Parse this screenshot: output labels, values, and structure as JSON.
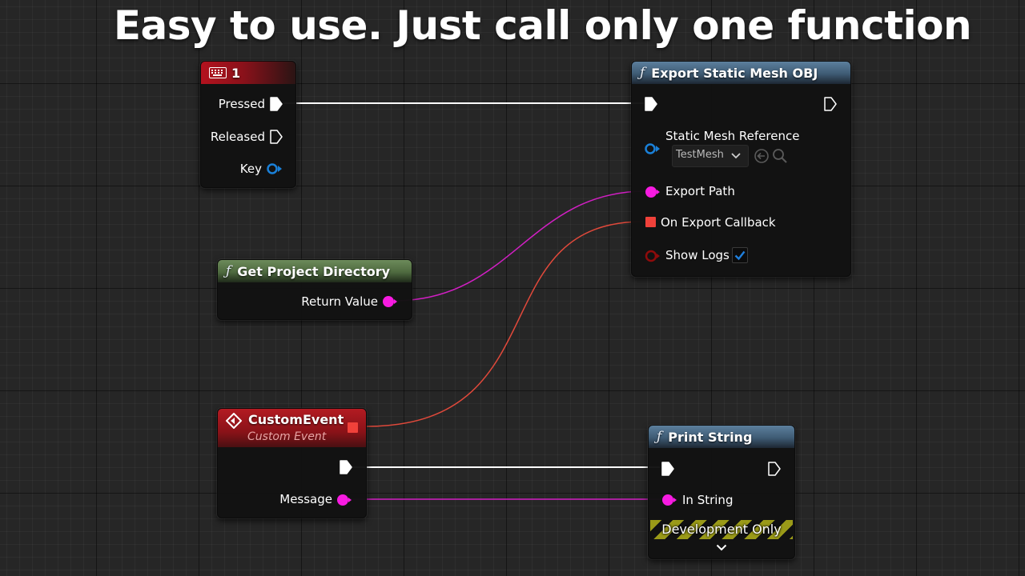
{
  "headline": "Easy to use. Just call only one function",
  "colors": {
    "exec_wire": "#ffffff",
    "string_pin": "#f71be1",
    "delegate_pin": "#f0413a",
    "struct_pin": "#1a80d8",
    "bool_pin": "#8f0b0b"
  },
  "nodes": {
    "key_event": {
      "icon": "keyboard-icon",
      "title": "1",
      "pins": {
        "pressed": "Pressed",
        "released": "Released",
        "key": "Key"
      }
    },
    "export_mesh": {
      "icon": "function-icon",
      "title": "Export Static Mesh OBJ",
      "pins": {
        "static_mesh_ref": "Static Mesh Reference",
        "export_path": "Export Path",
        "on_export_callback": "On Export Callback",
        "show_logs": "Show Logs"
      },
      "mesh_dropdown_value": "TestMesh",
      "show_logs_checked": true
    },
    "project_dir": {
      "icon": "function-icon",
      "title": "Get Project Directory",
      "pins": {
        "return_value": "Return Value"
      }
    },
    "custom_event": {
      "icon": "event-icon",
      "title": "CustomEvent",
      "subtitle": "Custom Event",
      "pins": {
        "message": "Message"
      }
    },
    "print_string": {
      "icon": "function-icon",
      "title": "Print String",
      "pins": {
        "in_string": "In String"
      },
      "badge": "Development Only"
    }
  }
}
